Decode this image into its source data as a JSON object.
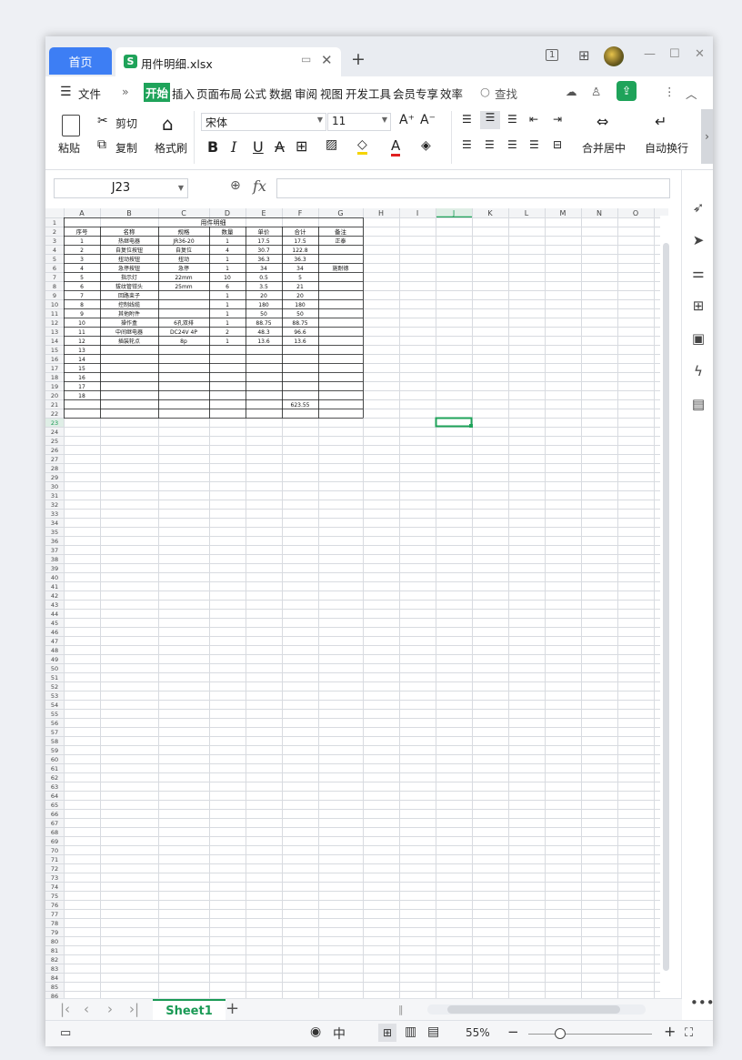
{
  "titlebar": {
    "home_tab": "首页",
    "doc_icon": "S",
    "doc_name": "用件明细.xlsx",
    "new_tab": "+",
    "controls": [
      "1",
      "⊞",
      "—",
      "☐",
      "✕"
    ]
  },
  "menubar": {
    "file": "文件",
    "items": [
      "开始",
      "插入",
      "页面布局",
      "公式",
      "数据",
      "审阅",
      "视图",
      "开发工具",
      "会员专享",
      "效率"
    ],
    "search": "查找"
  },
  "ribbon": {
    "paste": "粘贴",
    "cut": "剪切",
    "copy": "复制",
    "format_painter": "格式刷",
    "font_name": "宋体",
    "font_size": "11",
    "merge": "合并居中",
    "wrap": "自动换行",
    "bold": "B",
    "italic": "I",
    "underline": "U",
    "strike": "A",
    "font_color_letter": "A",
    "grow": "A⁺",
    "shrink": "A⁻",
    "colors": {
      "accent_green": "#1fa35a",
      "font_red": "#e02020",
      "highlight_yellow": "#f5d400",
      "home_blue": "#3d7ef4"
    }
  },
  "formula": {
    "cell_ref": "J23",
    "fx": "fx",
    "value": ""
  },
  "columns": [
    "A",
    "B",
    "C",
    "D",
    "E",
    "F",
    "G",
    "H",
    "I",
    "J",
    "K",
    "L",
    "M",
    "N",
    "O"
  ],
  "selected": {
    "column": "J",
    "row": 23
  },
  "table": {
    "title": "用件明细",
    "headers": [
      "序号",
      "名称",
      "规格",
      "数量",
      "单价",
      "合计",
      "备注"
    ],
    "rows": [
      [
        "1",
        "热继电器",
        "JR36-20",
        "1",
        "17.5",
        "17.5",
        "正泰"
      ],
      [
        "2",
        "自复位按钮",
        "自复位",
        "4",
        "30.7",
        "122.8",
        ""
      ],
      [
        "3",
        "扭动按钮",
        "扭动",
        "1",
        "36.3",
        "36.3",
        ""
      ],
      [
        "4",
        "急停按钮",
        "急停",
        "1",
        "34",
        "34",
        "施耐德"
      ],
      [
        "5",
        "指示灯",
        "22mm",
        "10",
        "0.5",
        "5",
        ""
      ],
      [
        "6",
        "拔纹管钳头",
        "25mm",
        "6",
        "3.5",
        "21",
        ""
      ],
      [
        "7",
        "回路束子",
        "",
        "1",
        "20",
        "20",
        ""
      ],
      [
        "8",
        "控制线缆",
        "",
        "1",
        "180",
        "180",
        ""
      ],
      [
        "9",
        "其他附件",
        "",
        "1",
        "50",
        "50",
        ""
      ],
      [
        "10",
        "操作盒",
        "6孔双排",
        "1",
        "88.75",
        "88.75",
        ""
      ],
      [
        "11",
        "中间继电器",
        "DC24V 4P",
        "2",
        "48.3",
        "96.6",
        ""
      ],
      [
        "12",
        "插装轮点",
        "8p",
        "1",
        "13.6",
        "13.6",
        ""
      ],
      [
        "13",
        "",
        "",
        "",
        "",
        "",
        ""
      ],
      [
        "14",
        "",
        "",
        "",
        "",
        "",
        ""
      ],
      [
        "15",
        "",
        "",
        "",
        "",
        "",
        ""
      ],
      [
        "16",
        "",
        "",
        "",
        "",
        "",
        ""
      ],
      [
        "17",
        "",
        "",
        "",
        "",
        "",
        ""
      ],
      [
        "18",
        "",
        "",
        "",
        "",
        "",
        ""
      ],
      [
        "",
        "",
        "",
        "",
        "",
        "623.55",
        ""
      ],
      [
        "",
        "",
        "",
        "",
        "",
        "",
        ""
      ]
    ]
  },
  "sheet": {
    "name": "Sheet1",
    "add": "+"
  },
  "status": {
    "zoom": "55%",
    "minus": "−",
    "plus": "+"
  },
  "row_count": 86
}
